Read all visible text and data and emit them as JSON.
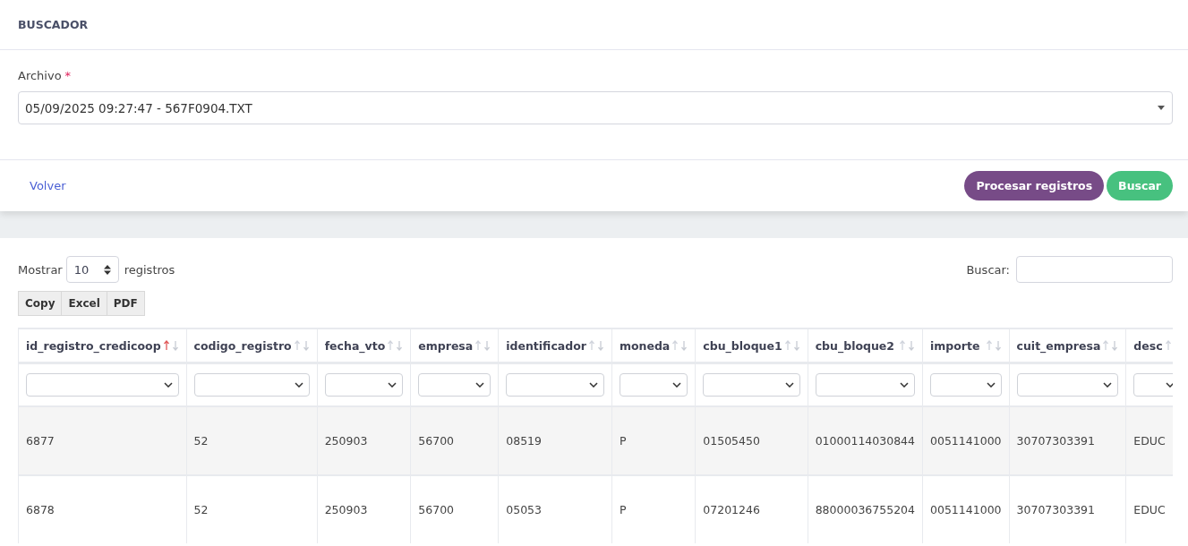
{
  "header": {
    "title": "BUSCADOR"
  },
  "file_field": {
    "label": "Archivo",
    "required_mark": "*",
    "value": "05/09/2025 09:27:47 - 567F0904.TXT"
  },
  "back_link": "Volver",
  "buttons": [
    {
      "label": "Procesar registros",
      "kind": "primary"
    },
    {
      "label": "Buscar",
      "kind": "success"
    }
  ],
  "length_control": {
    "prefix": "Mostrar",
    "value": "10",
    "suffix": "registros"
  },
  "search": {
    "label": "Buscar:"
  },
  "export_buttons": [
    "Copy",
    "Excel",
    "PDF"
  ],
  "table": {
    "columns": [
      {
        "label": "id_registro_credicoop",
        "sorted": true
      },
      {
        "label": "codigo_registro",
        "sorted": false
      },
      {
        "label": "fecha_vto",
        "sorted": false
      },
      {
        "label": "empresa",
        "sorted": false
      },
      {
        "label": "identificador",
        "sorted": false
      },
      {
        "label": "moneda",
        "sorted": false
      },
      {
        "label": "cbu_bloque1",
        "sorted": false
      },
      {
        "label": "cbu_bloque2",
        "sorted": false
      },
      {
        "label": "importe",
        "sorted": false
      },
      {
        "label": "cuit_empresa",
        "sorted": false
      },
      {
        "label": "desc",
        "sorted": false
      }
    ],
    "rows": [
      [
        "6877",
        "52",
        "250903",
        "56700",
        "08519",
        "P",
        "01505450",
        "01000114030844",
        "0051141000",
        "30707303391",
        "EDUC"
      ],
      [
        "6878",
        "52",
        "250903",
        "56700",
        "05053",
        "P",
        "07201246",
        "88000036755204",
        "0051141000",
        "30707303391",
        "EDUC"
      ]
    ]
  }
}
